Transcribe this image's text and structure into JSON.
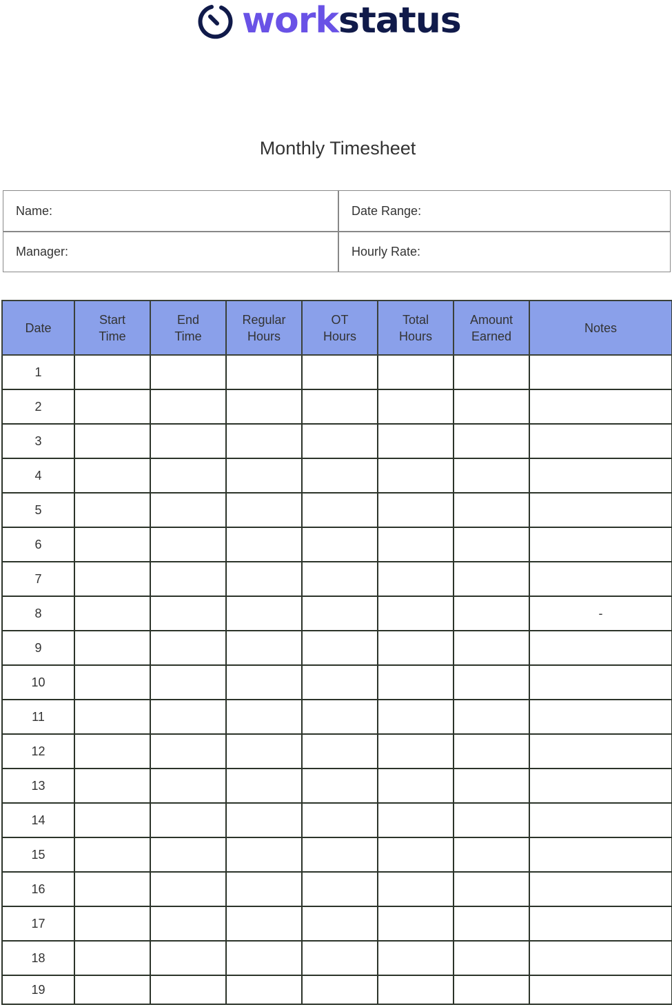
{
  "brand": {
    "name_part1": "work",
    "name_part2": "status",
    "logo_icon": "stopwatch-icon",
    "colors": {
      "primary": "#6952e6",
      "dark": "#101a4a"
    }
  },
  "document": {
    "title": "Monthly Timesheet"
  },
  "info_fields": {
    "name_label": "Name:",
    "date_range_label": "Date Range:",
    "manager_label": "Manager:",
    "hourly_rate_label": "Hourly Rate:"
  },
  "table": {
    "header_color": "#8aa0ea",
    "columns": [
      {
        "line1": "Date",
        "line2": ""
      },
      {
        "line1": "Start",
        "line2": "Time"
      },
      {
        "line1": "End",
        "line2": "Time"
      },
      {
        "line1": "Regular",
        "line2": "Hours"
      },
      {
        "line1": "OT",
        "line2": "Hours"
      },
      {
        "line1": "Total",
        "line2": "Hours"
      },
      {
        "line1": "Amount",
        "line2": "Earned"
      },
      {
        "line1": "Notes",
        "line2": ""
      }
    ],
    "rows": [
      {
        "date": "1",
        "notes": ""
      },
      {
        "date": "2",
        "notes": ""
      },
      {
        "date": "3",
        "notes": ""
      },
      {
        "date": "4",
        "notes": ""
      },
      {
        "date": "5",
        "notes": ""
      },
      {
        "date": "6",
        "notes": ""
      },
      {
        "date": "7",
        "notes": ""
      },
      {
        "date": "8",
        "notes": "-"
      },
      {
        "date": "9",
        "notes": ""
      },
      {
        "date": "10",
        "notes": ""
      },
      {
        "date": "11",
        "notes": ""
      },
      {
        "date": "12",
        "notes": ""
      },
      {
        "date": "13",
        "notes": ""
      },
      {
        "date": "14",
        "notes": ""
      },
      {
        "date": "15",
        "notes": ""
      },
      {
        "date": "16",
        "notes": ""
      },
      {
        "date": "17",
        "notes": ""
      },
      {
        "date": "18",
        "notes": ""
      },
      {
        "date": "19",
        "notes": ""
      }
    ]
  }
}
